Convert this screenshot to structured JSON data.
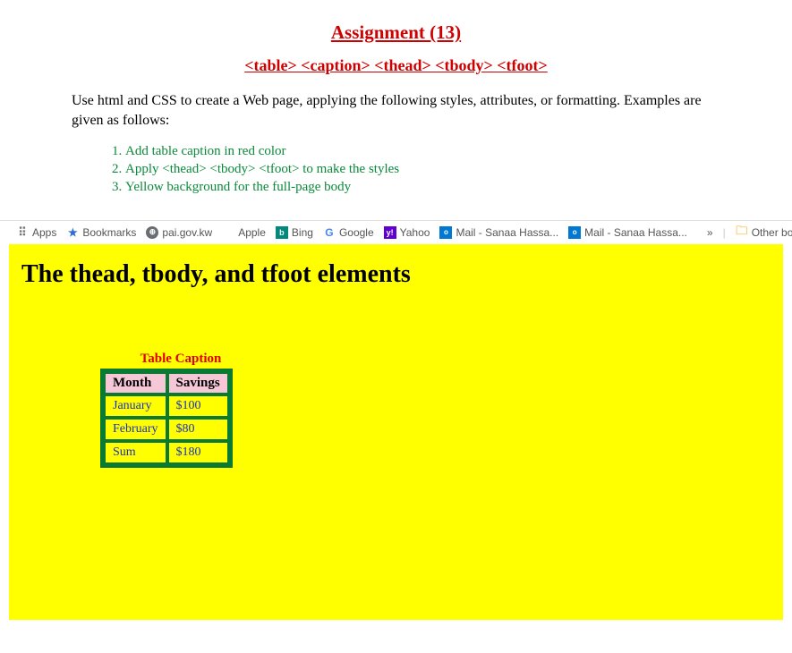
{
  "heading": {
    "title": "Assignment (13)",
    "subtitle": "<table> <caption>  <thead>  <tbody> <tfoot>"
  },
  "intro": "Use html and CSS to create a Web page, applying the following styles, attributes, or formatting. Examples are given as follows:",
  "steps": [
    "Add table caption in red color",
    "Apply <thead> <tbody> <tfoot> to make the styles",
    "Yellow background for the full-page body"
  ],
  "bookmarks": {
    "apps": "Apps",
    "items": [
      "Bookmarks",
      "pai.gov.kw",
      "Apple",
      "Bing",
      "Google",
      "Yahoo",
      "Mail - Sanaa Hassa...",
      "Mail - Sanaa Hassa..."
    ],
    "other": "Other bookmarks"
  },
  "rendered": {
    "heading": "The thead, tbody, and tfoot elements",
    "caption": "Table Caption",
    "thead": [
      "Month",
      "Savings"
    ],
    "rows": [
      [
        "January",
        "$100"
      ],
      [
        "February",
        "$80"
      ],
      [
        "Sum",
        "$180"
      ]
    ]
  }
}
